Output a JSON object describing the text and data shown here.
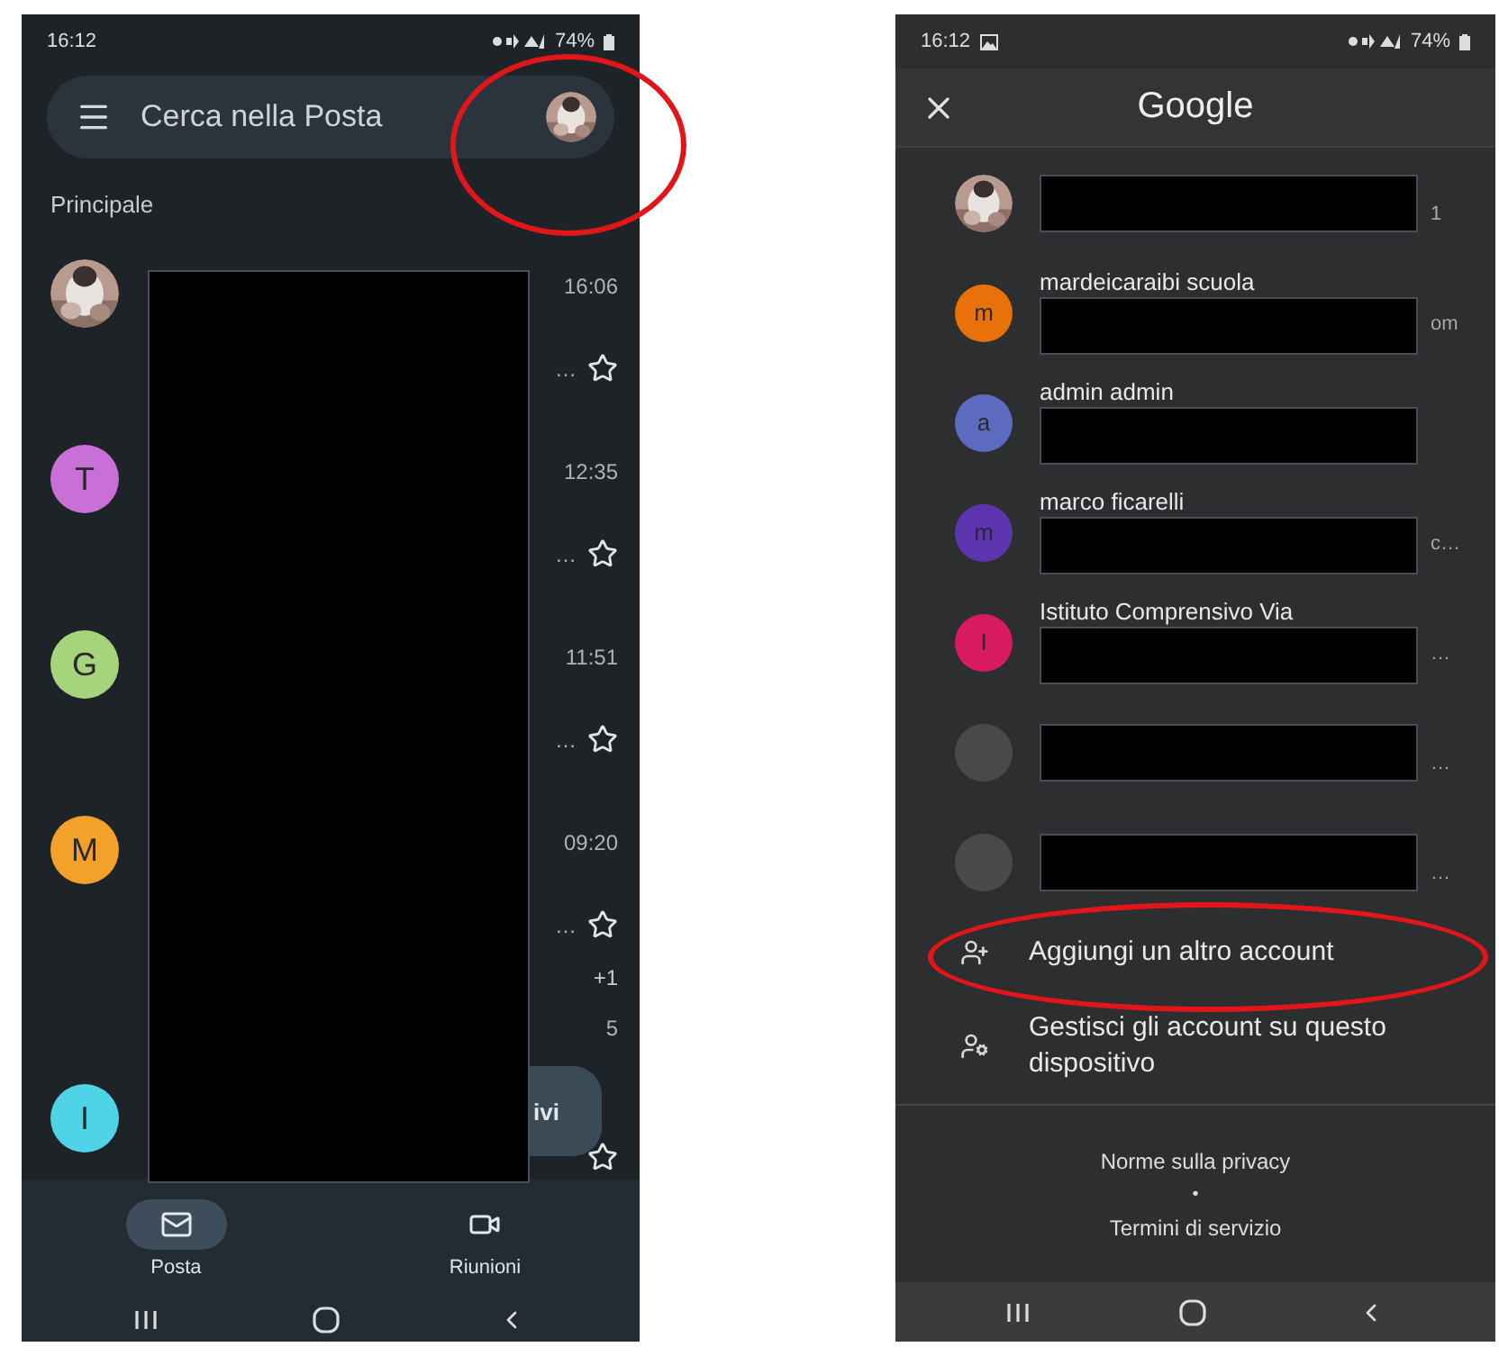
{
  "left_screen": {
    "status_bar": {
      "time": "16:12",
      "battery": "74%"
    },
    "search": {
      "placeholder": "Cerca nella Posta",
      "highlight": true
    },
    "section": "Principale",
    "redaction": true,
    "emails": [
      {
        "time": "16:06",
        "snippet": "…",
        "starred": false
      },
      {
        "avatar": {
          "kind": "letter",
          "letter": "T",
          "color": "#c96fd8"
        },
        "time": "12:35",
        "snippet": "…",
        "starred": false
      },
      {
        "avatar": {
          "kind": "letter",
          "letter": "G",
          "color": "#a6d47c"
        },
        "time": "11:51",
        "snippet": "…",
        "starred": false
      },
      {
        "avatar": {
          "kind": "letter",
          "letter": "M",
          "color": "#f4a12b"
        },
        "time": "09:20",
        "snippet": "…",
        "starred": false,
        "chip": "+1"
      },
      {
        "avatar": {
          "kind": "letter",
          "letter": "I",
          "color": "#4fd3e6"
        },
        "time": "5",
        "starred": false
      }
    ],
    "compose_button": "ivi",
    "bottom_nav": [
      {
        "kind": "mail",
        "label": "Posta",
        "selected": true
      },
      {
        "kind": "video",
        "label": "Riunioni",
        "selected": false
      }
    ]
  },
  "right_screen": {
    "status_bar": {
      "time": "16:12",
      "battery": "74%"
    },
    "title": "Google",
    "accounts": [
      {
        "redacted": true,
        "tail": "1"
      },
      {
        "avatar": {
          "kind": "letter",
          "letter": "m",
          "color": "#e8710a"
        },
        "name": "mardeicaraibi scuola",
        "redacted": true,
        "tail": "om"
      },
      {
        "avatar": {
          "kind": "letter",
          "letter": "a",
          "color": "#5c6bc0"
        },
        "name": "admin admin",
        "redacted": true
      },
      {
        "avatar": {
          "kind": "letter",
          "letter": "m",
          "color": "#5e35b1"
        },
        "name": "marco ficarelli",
        "redacted": true,
        "tail": "c…"
      },
      {
        "avatar": {
          "kind": "letter",
          "letter": "I",
          "color": "#d81b60"
        },
        "name": "Istituto Comprensivo Via",
        "redacted": true,
        "tail": "…"
      },
      {
        "avatar": {
          "kind": "blank"
        },
        "redacted": true,
        "tail": "…"
      },
      {
        "avatar": {
          "kind": "blank"
        },
        "redacted": true,
        "tail": "…"
      }
    ],
    "actions": [
      {
        "kind": "add",
        "label": "Aggiungi un altro account",
        "highlight": true
      },
      {
        "kind": "manage",
        "label": "Gestisci gli account su questo dispositivo",
        "highlight": false
      }
    ],
    "footer": {
      "privacy": "Norme sulla privacy",
      "separator": "•",
      "terms": "Termini di servizio"
    }
  }
}
